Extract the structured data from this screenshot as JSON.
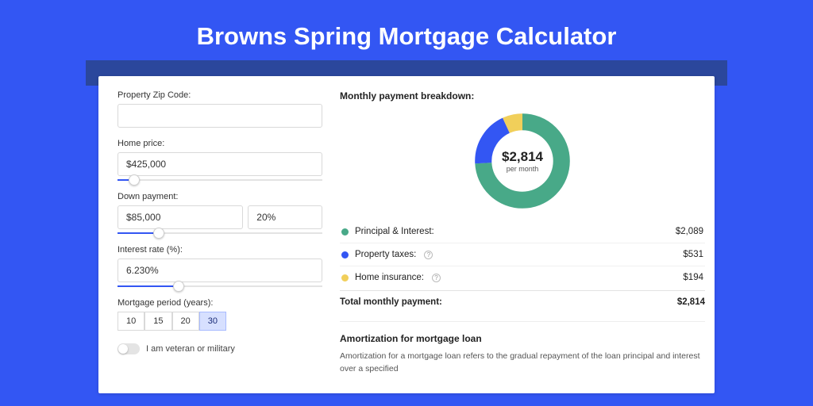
{
  "title": "Browns Spring Mortgage Calculator",
  "form": {
    "zip_label": "Property Zip Code:",
    "zip_value": "",
    "home_price_label": "Home price:",
    "home_price_value": "$425,000",
    "home_price_slider_pct": 8,
    "down_payment_label": "Down payment:",
    "down_payment_value": "$85,000",
    "down_payment_pct_value": "20%",
    "down_payment_slider_pct": 20,
    "interest_label": "Interest rate (%):",
    "interest_value": "6.230%",
    "interest_slider_pct": 30,
    "period_label": "Mortgage period (years):",
    "periods": [
      "10",
      "15",
      "20",
      "30"
    ],
    "period_selected": "30",
    "veteran_label": "I am veteran or military",
    "veteran_on": false
  },
  "breakdown": {
    "title": "Monthly payment breakdown:",
    "donut_value": "$2,814",
    "donut_sub": "per month",
    "items": [
      {
        "label": "Principal & Interest:",
        "value": "$2,089",
        "color": "#48a988",
        "pct": 74,
        "info": false
      },
      {
        "label": "Property taxes:",
        "value": "$531",
        "color": "#3356f3",
        "pct": 19,
        "info": true
      },
      {
        "label": "Home insurance:",
        "value": "$194",
        "color": "#f1cf5a",
        "pct": 7,
        "info": true
      }
    ],
    "total_label": "Total monthly payment:",
    "total_value": "$2,814"
  },
  "amortization": {
    "title": "Amortization for mortgage loan",
    "text": "Amortization for a mortgage loan refers to the gradual repayment of the loan principal and interest over a specified"
  },
  "chart_data": {
    "type": "pie",
    "title": "Monthly payment breakdown",
    "categories": [
      "Principal & Interest",
      "Property taxes",
      "Home insurance"
    ],
    "values": [
      2089,
      531,
      194
    ],
    "colors": [
      "#48a988",
      "#3356f3",
      "#f1cf5a"
    ],
    "total": 2814,
    "unit": "USD per month"
  }
}
